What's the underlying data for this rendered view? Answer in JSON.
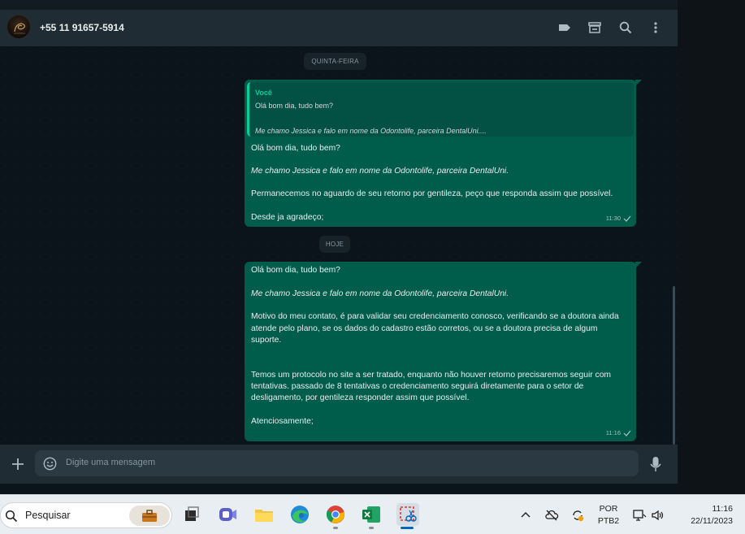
{
  "header": {
    "contact_name": "+55 11 91657-5914",
    "icons": [
      "label-icon",
      "shop-icon",
      "search-icon",
      "menu-icon"
    ]
  },
  "chat": {
    "date_separators": [
      "QUINTA-FEIRA",
      "HOJE"
    ],
    "messages": [
      {
        "quote": {
          "author": "Você",
          "line1": "Olá bom dia, tudo bem?",
          "line2": "Me chamo Jessica e falo em nome da Odontolife, parceira DentalUni...."
        },
        "lines": [
          "Olá bom dia, tudo bem?",
          "Me chamo Jessica e falo em nome da Odontolife, parceira DentalUni.",
          "Permanecemos no aguardo de seu retorno por gentileza, peço que responda assim que possível.",
          "Desde ja agradeço;"
        ],
        "time": "11:30",
        "status": "sent-check"
      },
      {
        "lines": [
          "Olá bom dia, tudo bem?",
          "Me chamo Jessica e falo em nome da Odontolife, parceira DentalUni.",
          "Motivo do meu contato, é para validar seu credenciamento conosco, verificando se a doutora ainda",
          "atende pelo plano, se os dados do cadastro estão corretos, ou se a doutora precisa de algum",
          "suporte.",
          "Temos um protocolo no site a ser tratado, enquanto não houver retorno precisaremos seguir com",
          "tentativas. passado de 8 tentativas o credenciamento seguirá diretamente para o setor de",
          "desligamento, por gentileza responder assim que possível.",
          "Atenciosamente;"
        ],
        "time": "11:16",
        "status": "sent-check"
      }
    ]
  },
  "composer": {
    "placeholder": "Digite uma mensagem"
  },
  "taskbar": {
    "search_label": "Pesquisar",
    "apps": [
      "task-view-icon",
      "teams-icon",
      "file-explorer-icon",
      "edge-icon",
      "chrome-icon",
      "excel-icon",
      "snipping-tool-icon"
    ],
    "language_line1": "POR",
    "language_line2": "PTB2",
    "time": "11:16",
    "date": "22/11/2023"
  },
  "colors": {
    "outgoing_bubble": "#005c4b",
    "panel": "#202c33",
    "background": "#0b141a",
    "accent": "#06cf9c"
  }
}
